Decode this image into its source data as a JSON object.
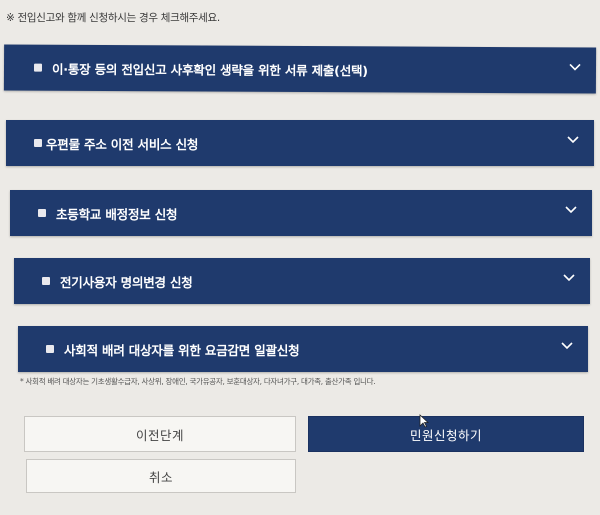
{
  "notice": "※ 전입신고와 함께 신청하시는 경우 체크해주세요.",
  "options": [
    {
      "label": "이·통장 등의 전입신고 사후확인 생략을 위한 서류 제출(선택)"
    },
    {
      "label": "우편물 주소 이전 서비스 신청"
    },
    {
      "label": "초등학교 배정정보 신청"
    },
    {
      "label": "전기사용자 명의변경 신청"
    },
    {
      "label": "사회적 배려 대상자를 위한 요금감면 일괄신청"
    }
  ],
  "footnote": "* 사회적 배려 대상자는 기초생활수급자, 사상위, 장애인, 국가유공자, 보훈대상자, 다자녀가구, 대가족, 출산가족 입니다.",
  "buttons": {
    "prev": "이전단계",
    "submit": "민원신청하기",
    "cancel": "취소"
  },
  "colors": {
    "accent": "#1f3a6d",
    "background": "#eceae6"
  },
  "icons": {
    "checkbox": "checkbox-icon",
    "expand": "chevron-down-icon"
  }
}
